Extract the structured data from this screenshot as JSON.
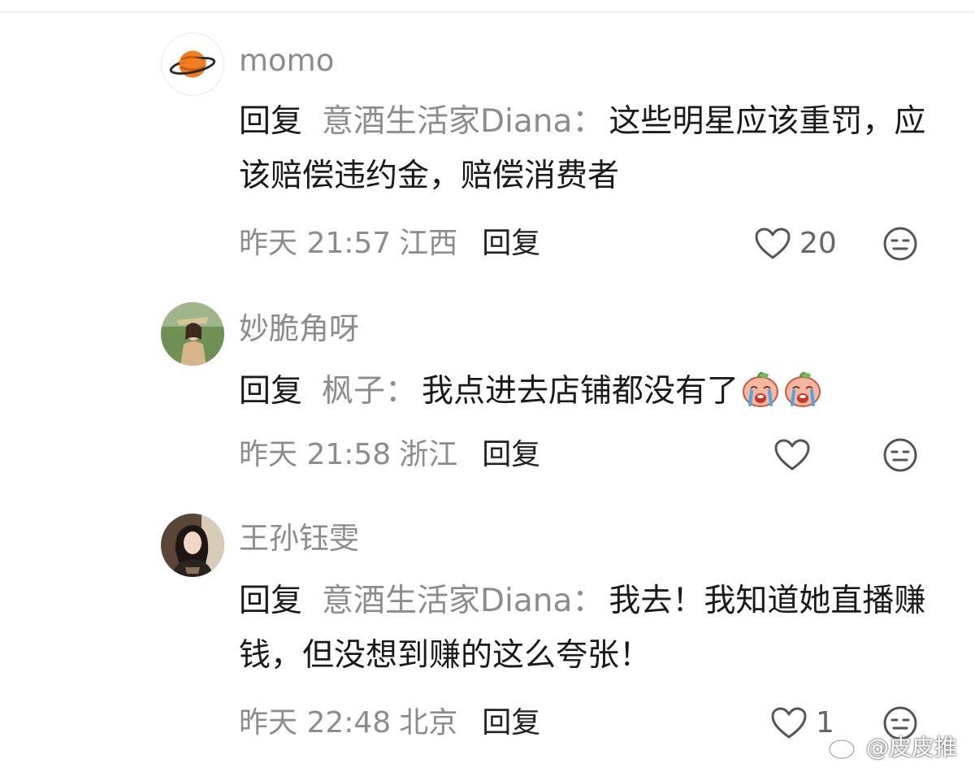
{
  "comments": [
    {
      "username": "momo",
      "avatar": "planet-icon",
      "reply_prefix": "回复",
      "reply_target": "意酒生活家Diana",
      "colon": "：",
      "text": "这些明星应该重罚，应该赔偿违约金，赔偿消费者",
      "time": "昨天 21:57",
      "location": "江西",
      "reply_label": "回复",
      "likes": "20"
    },
    {
      "username": "妙脆角呀",
      "avatar": "user-photo",
      "reply_prefix": "回复",
      "reply_target": "枫子",
      "colon": "：",
      "text": "我点进去店铺都没有了",
      "emojis": [
        "crying-emoji",
        "crying-emoji"
      ],
      "time": "昨天 21:58",
      "location": "浙江",
      "reply_label": "回复",
      "likes": ""
    },
    {
      "username": "王孙钰雯",
      "avatar": "user-photo",
      "reply_prefix": "回复",
      "reply_target": "意酒生活家Diana",
      "colon": "：",
      "text": "我去！我知道她直播赚钱，但没想到赚的这么夸张！",
      "time": "昨天 22:48",
      "location": "北京",
      "reply_label": "回复",
      "likes": "1"
    }
  ],
  "watermark": {
    "text": "@皮皮推",
    "icon": "weibo-logo-icon"
  },
  "colors": {
    "primary_text": "#1a1a1a",
    "secondary_text": "#8c8c8c",
    "icon_stroke": "#555555"
  }
}
